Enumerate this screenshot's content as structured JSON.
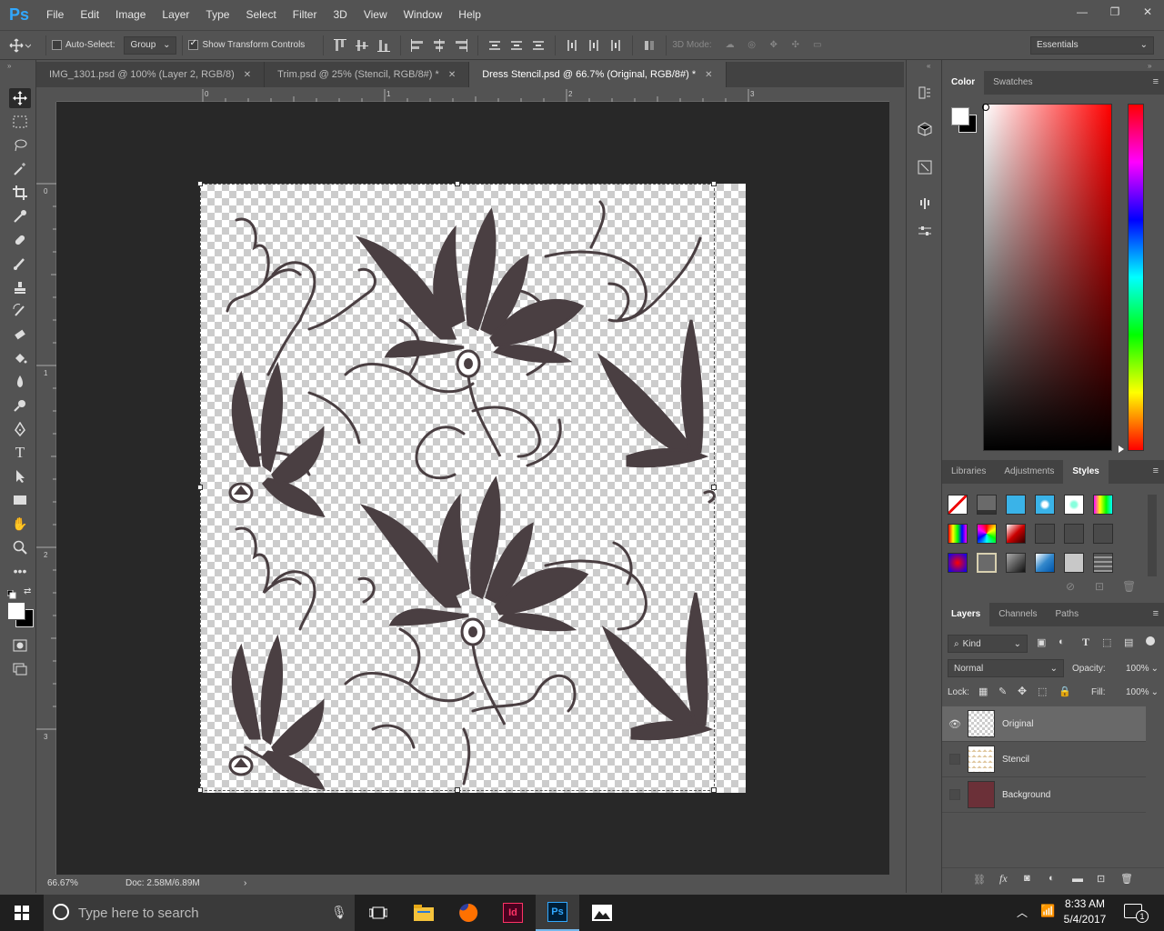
{
  "app": {
    "logo": "Ps",
    "menu": [
      "File",
      "Edit",
      "Image",
      "Layer",
      "Type",
      "Select",
      "Filter",
      "3D",
      "View",
      "Window",
      "Help"
    ],
    "window_controls": [
      "—",
      "❐",
      "✕"
    ]
  },
  "options": {
    "auto_select_label": "Auto-Select:",
    "auto_select_value": "Group",
    "show_transform_label": "Show Transform Controls",
    "mode_3d_label": "3D Mode:",
    "workspace": "Essentials"
  },
  "tabs": [
    {
      "label": "IMG_1301.psd @ 100% (Layer 2, RGB/8)",
      "active": false
    },
    {
      "label": "Trim.psd @ 25% (Stencil, RGB/8#) *",
      "active": false
    },
    {
      "label": "Dress Stencil.psd @ 66.7% (Original, RGB/8#) *",
      "active": true
    }
  ],
  "tab_close": "✕",
  "ruler": {
    "top_marks": [
      "0",
      "1",
      "2",
      "3"
    ],
    "left_marks": [
      "0",
      "1",
      "2",
      "3"
    ]
  },
  "status": {
    "zoom": "66.67%",
    "doc": "Doc: 2.58M/6.89M",
    "arrow": "›"
  },
  "color_panel": {
    "tabs": [
      "Color",
      "Swatches"
    ],
    "active": "Color",
    "foreground": "#ffffff",
    "background": "#000000"
  },
  "styles_panel": {
    "tabs": [
      "Libraries",
      "Adjustments",
      "Styles"
    ],
    "active": "Styles"
  },
  "layers_panel": {
    "tabs": [
      "Layers",
      "Channels",
      "Paths"
    ],
    "active": "Layers",
    "filter_label": "Kind",
    "blend_mode": "Normal",
    "opacity_label": "Opacity:",
    "opacity_value": "100%",
    "lock_label": "Lock:",
    "fill_label": "Fill:",
    "fill_value": "100%",
    "layers": [
      {
        "name": "Original",
        "visible": true,
        "selected": true
      },
      {
        "name": "Stencil",
        "visible": false,
        "selected": false
      },
      {
        "name": "Background",
        "visible": false,
        "selected": false
      }
    ],
    "footer_fx": "fx"
  },
  "taskbar": {
    "search_placeholder": "Type here to search",
    "time": "8:33 AM",
    "date": "5/4/2017",
    "notification_count": "1",
    "apps": [
      "file-explorer",
      "firefox",
      "indesign",
      "photoshop",
      "photos"
    ],
    "indesign_label": "Id",
    "photoshop_label": "Ps"
  },
  "colors": {
    "ui_bg": "#535353",
    "canvas_bg": "#282828",
    "accent": "#31a8ff",
    "stencil_ink": "#4a3f42",
    "background_layer": "#6b3038"
  }
}
